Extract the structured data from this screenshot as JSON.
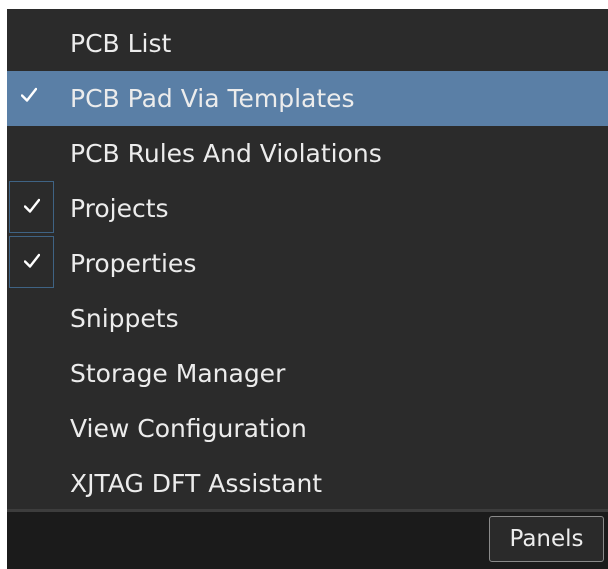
{
  "menu": {
    "items": [
      {
        "label": "PCB List",
        "checked": false,
        "highlighted": false
      },
      {
        "label": "PCB Pad Via Templates",
        "checked": true,
        "highlighted": true
      },
      {
        "label": "PCB Rules And Violations",
        "checked": false,
        "highlighted": false
      },
      {
        "label": "Projects",
        "checked": true,
        "highlighted": false
      },
      {
        "label": "Properties",
        "checked": true,
        "highlighted": false
      },
      {
        "label": "Snippets",
        "checked": false,
        "highlighted": false
      },
      {
        "label": "Storage Manager",
        "checked": false,
        "highlighted": false
      },
      {
        "label": "View Configuration",
        "checked": false,
        "highlighted": false
      },
      {
        "label": "XJTAG DFT Assistant",
        "checked": false,
        "highlighted": false
      }
    ]
  },
  "footer": {
    "panels_label": "Panels"
  },
  "colors": {
    "menu_background": "#2b2b2b",
    "highlight": "#5a7fa6",
    "check_border": "#3f6384",
    "text": "#ececec",
    "footer_background": "#1b1b1b"
  }
}
